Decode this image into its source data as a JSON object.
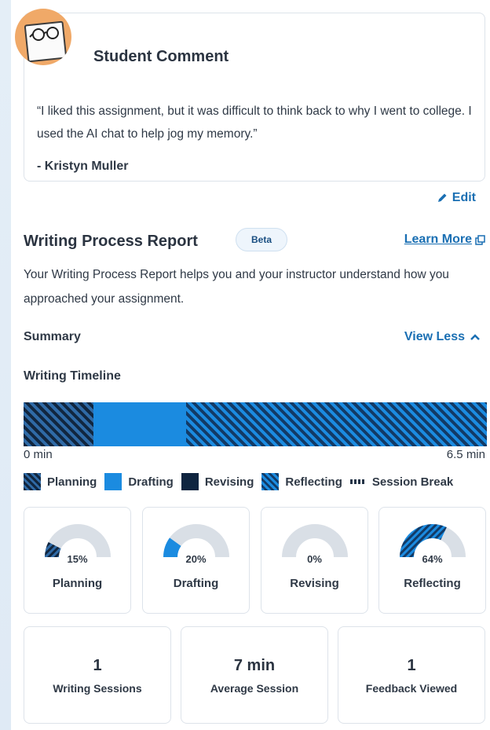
{
  "comment": {
    "title": "Student Comment",
    "text": "“I liked this assignment, but it was difficult to think back to why I went to college. I used the AI chat to help jog my memory.”",
    "author": "- Kristyn Muller",
    "edit_label": "Edit",
    "edit_icon": "pencil-icon"
  },
  "report": {
    "title": "Writing Process Report",
    "badge": "Beta",
    "learn_more": "Learn More",
    "learn_more_icon": "external-link-icon",
    "description": "Your Writing Process Report helps you and your instructor understand how you approached your assignment.",
    "summary_label": "Summary",
    "view_less": "View Less",
    "view_less_icon": "chevron-up-icon",
    "timeline_label": "Writing Timeline",
    "timeline": {
      "start": "0 min",
      "end": "6.5 min",
      "segments": [
        {
          "phase": "Planning",
          "fraction": 0.15
        },
        {
          "phase": "Drafting",
          "fraction": 0.2
        },
        {
          "phase": "Reflecting",
          "fraction": 0.65
        }
      ]
    },
    "legend": [
      {
        "label": "Planning",
        "color": "#11263f"
      },
      {
        "label": "Drafting",
        "color": "#1b8be0"
      },
      {
        "label": "Revising",
        "color": "#0f2540"
      },
      {
        "label": "Reflecting",
        "color": "#123a66"
      },
      {
        "label": "Session Break",
        "color": "#243447"
      }
    ],
    "gauges": [
      {
        "label": "Planning",
        "pct_text": "15%",
        "value": 0.15,
        "style": "planning"
      },
      {
        "label": "Drafting",
        "pct_text": "20%",
        "value": 0.2,
        "style": "drafting"
      },
      {
        "label": "Revising",
        "pct_text": "0%",
        "value": 0,
        "style": "revising"
      },
      {
        "label": "Reflecting",
        "pct_text": "64%",
        "value": 0.64,
        "style": "reflecting"
      }
    ],
    "stats": [
      {
        "value": "1",
        "label": "Writing Sessions"
      },
      {
        "value": "7 min",
        "label": "Average Session"
      },
      {
        "value": "1",
        "label": "Feedback Viewed"
      }
    ]
  },
  "colors": {
    "accent": "#1a6fb3",
    "drafting": "#1b8be0",
    "dark": "#11263f",
    "gauge_track": "#d9dfe6",
    "avatar_bg": "#f0a968"
  }
}
